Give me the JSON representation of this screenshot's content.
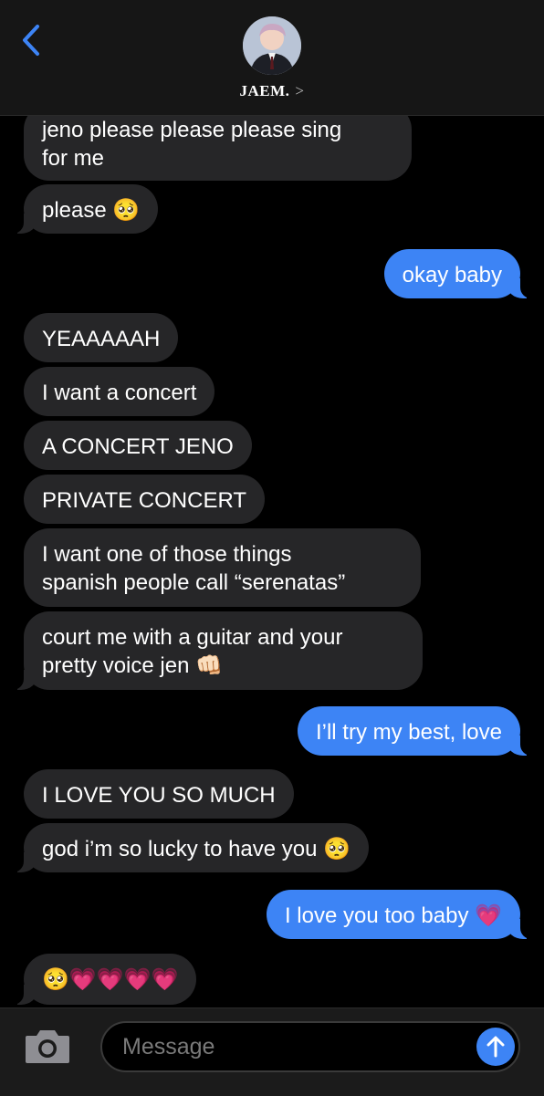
{
  "header": {
    "contact_name": "JAEM.",
    "chevron": ">"
  },
  "composer": {
    "placeholder": "Message"
  },
  "colors": {
    "incoming": "#262628",
    "outgoing": "#3d84f5",
    "background": "#000000"
  },
  "messages": [
    {
      "from": "them",
      "text": "jeno please please please sing\nfor me"
    },
    {
      "from": "them",
      "text": "please 🥺"
    },
    {
      "from": "me",
      "text": "okay baby"
    },
    {
      "from": "them",
      "text": "YEAAAAAH"
    },
    {
      "from": "them",
      "text": "I want a concert"
    },
    {
      "from": "them",
      "text": "A CONCERT JENO"
    },
    {
      "from": "them",
      "text": "PRIVATE CONCERT"
    },
    {
      "from": "them",
      "text": "I want one of those things\nspanish people call “serenatas”"
    },
    {
      "from": "them",
      "text": "court me with a guitar and your\npretty voice jen 👊🏻"
    },
    {
      "from": "me",
      "text": "I’ll try my best, love"
    },
    {
      "from": "them",
      "text": "I LOVE YOU SO MUCH"
    },
    {
      "from": "them",
      "text": "god i’m so lucky to have you 🥺"
    },
    {
      "from": "me",
      "text": "I love you too baby 💗"
    },
    {
      "from": "them",
      "text": "🥺💗💗💗💗"
    }
  ]
}
